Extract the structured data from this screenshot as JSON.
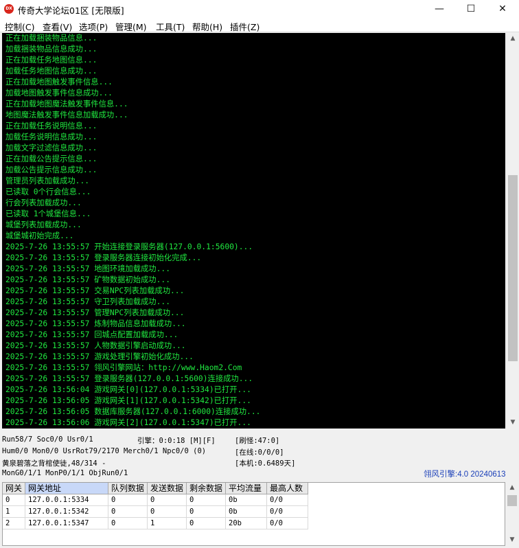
{
  "window": {
    "app_icon_text": "DX",
    "title": "传奇大学论坛01区 [无限版]",
    "min_glyph": "—",
    "max_glyph": "☐",
    "close_glyph": "✕"
  },
  "menu": [
    "控制(C)",
    "查看(V)",
    "选项(P)",
    "管理(M)",
    "工具(T)",
    "帮助(H)",
    "插件(Z)"
  ],
  "console": {
    "lines": [
      "正在加载捆装物品信息...",
      "加载捆装物品信息成功...",
      "正在加载任务地图信息...",
      "加载任务地图信息成功...",
      "正在加载地图触发事件信息...",
      "加载地图触发事件信息成功...",
      "正在加载地图魔法触发事件信息...",
      "地图魔法触发事件信息加载成功...",
      "正在加载任务说明信息...",
      "加载任务说明信息成功...",
      "加载文字过滤信息成功...",
      "正在加载公告提示信息...",
      "加载公告提示信息成功...",
      "管理员列表加载成功...",
      "已读取 0个行会信息...",
      "行会列表加载成功...",
      "已读取 1个城堡信息...",
      "城堡列表加载成功...",
      "城堡城初始完成...",
      "2025-7-26 13:55:57 开始连接登录服务器(127.0.0.1:5600)...",
      "2025-7-26 13:55:57 登录服务器连接初始化完成...",
      "2025-7-26 13:55:57 地图环境加载成功...",
      "2025-7-26 13:55:57 矿物数据初始成功...",
      "2025-7-26 13:55:57 交易NPC列表加载成功...",
      "2025-7-26 13:55:57 守卫列表加载成功...",
      "2025-7-26 13:55:57 管理NPC列表加载成功...",
      "2025-7-26 13:55:57 炼制物品信息加载成功...",
      "2025-7-26 13:55:57 回城点配置加载成功...",
      "2025-7-26 13:55:57 人物数据引擎启动成功...",
      "2025-7-26 13:55:57 游戏处理引擎初始化成功...",
      "2025-7-26 13:55:57 翎风引擎网站：http://www.Haom2.Com",
      "2025-7-26 13:55:57 登录服务器(127.0.0.1:5600)连接成功...",
      "2025-7-26 13:56:04 游戏网关[0](127.0.0.1:5334)已打开...",
      "2025-7-26 13:56:05 游戏网关[1](127.0.0.1:5342)已打开...",
      "2025-7-26 13:56:05 数据库服务器(127.0.0.1:6000)连接成功...",
      "2025-7-26 13:56:06 游戏网关[2](127.0.0.1:5347)已打开..."
    ],
    "text_color": "#20e840",
    "background": "#000000"
  },
  "console_scrollbar": {
    "up_glyph": "▲",
    "down_glyph": "▼",
    "position": 0.7,
    "visible_fraction": 0.5
  },
  "status": {
    "line1_left": "Run58/7 Soc0/0 Usr0/1",
    "engine": "引擎：0:0:18 [M][F]",
    "refresh": "[刷怪:47:0]",
    "line2_left": "Hum0/0 Mon0/0 UsrRot79/2170 Merch0/1 Npc0/0 (0)",
    "online": "[在线:0/0/0]",
    "line3_left": "黄泉碧落之背棺使徒,48/314 -",
    "local": "[本机:0.6489天]",
    "line4_left": "MonG0/1/1 MonP0/1/1 ObjRun0/1",
    "version": "翎风引擎:4.0 20240613",
    "version_color": "#1a3fb8"
  },
  "gate_table": {
    "headers": [
      "网关",
      "网关地址",
      "队列数据",
      "发送数据",
      "剩余数据",
      "平均流量",
      "最高人数"
    ],
    "rows": [
      [
        "0",
        "127.0.0.1:5334",
        "0",
        "0",
        "0",
        "0b",
        "0/0"
      ],
      [
        "1",
        "127.0.0.1:5342",
        "0",
        "0",
        "0",
        "0b",
        "0/0"
      ],
      [
        "2",
        "127.0.0.1:5347",
        "0",
        "1",
        "0",
        "20b",
        "0/0"
      ]
    ]
  }
}
